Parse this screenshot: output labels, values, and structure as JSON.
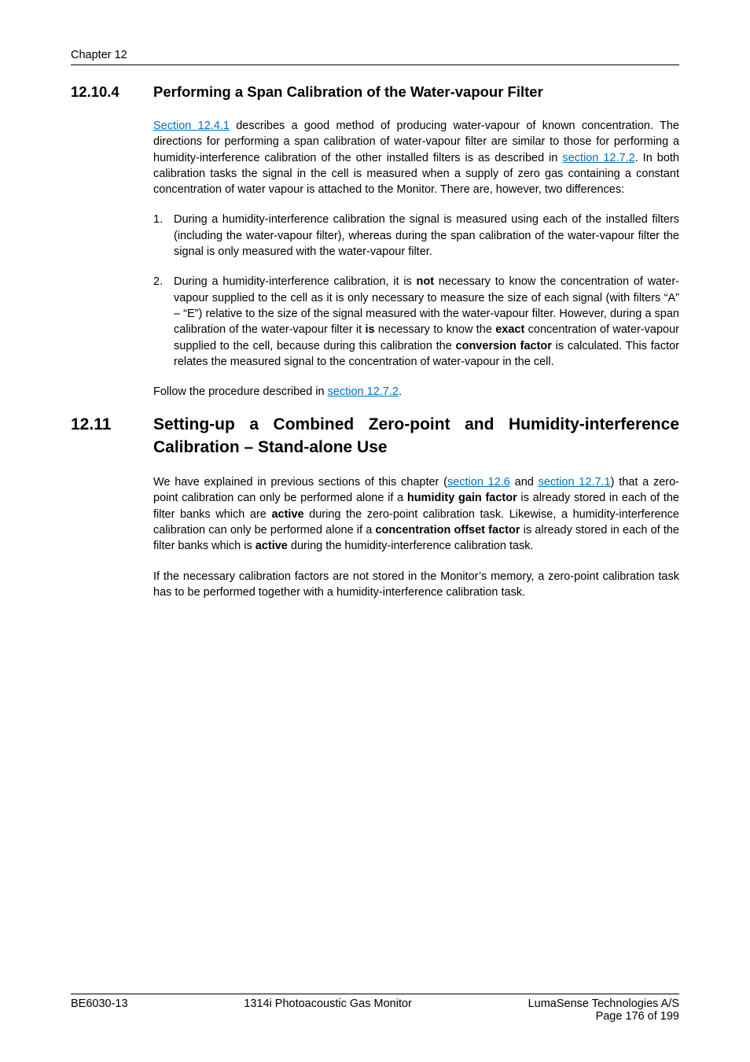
{
  "header": {
    "chapter": "Chapter 12"
  },
  "section_12_10_4": {
    "number": "12.10.4",
    "title": "Performing a Span Calibration of the Water-vapour Filter",
    "para1_a": "Section 12.4.1",
    "para1_b": " describes a good method of producing water-vapour of known concentration. The directions for performing a span calibration of water-vapour filter are similar to those for performing a humidity-interference calibration of the other installed filters is as described in ",
    "para1_c": "section 12.7.2",
    "para1_d": ". In both calibration tasks the signal in the cell is measured when a supply of zero gas containing a constant concentration of water vapour is attached to the Monitor. There are, however, two differences:",
    "li1_num": "1.",
    "li1_text": "During a humidity-interference calibration the signal is measured using each of the installed filters (including the water-vapour filter), whereas during the span calibration of the water-vapour filter the signal is only measured with the water-vapour filter.",
    "li2_num": "2.",
    "li2_a": "During a humidity-interference calibration, it is ",
    "li2_b": "not",
    "li2_c": " necessary to know the concentration of water-vapour supplied to the cell as it is only necessary to measure the size of each signal (with filters “A” – “E”) relative to the size of the signal measured with the water-vapour filter. However, during a span calibration of the water-vapour filter it ",
    "li2_d": "is",
    "li2_e": " necessary to know the ",
    "li2_f": "exact",
    "li2_g": " concentration of water-vapour supplied to the cell, because during this calibration the ",
    "li2_h": "conversion factor",
    "li2_i": " is calculated. This factor relates the measured signal to the concentration of water-vapour in the cell.",
    "para2_a": "Follow the procedure described in ",
    "para2_b": "section 12.7.2",
    "para2_c": "."
  },
  "section_12_11": {
    "number": "12.11",
    "title": "Setting-up a Combined Zero-point and Humidity-interference Calibration – Stand-alone Use",
    "para1_a": "We have explained in previous sections of this chapter (",
    "para1_b": "section 12.6",
    "para1_c": " and ",
    "para1_d": "section 12.7.1",
    "para1_e": ") that a zero-point calibration can only be performed alone if a ",
    "para1_f": "humidity gain factor",
    "para1_g": " is already stored in each of the filter banks which are ",
    "para1_h": "active",
    "para1_i": " during the zero-point calibration task. Likewise, a humidity-interference calibration can only be performed alone if a ",
    "para1_j": "concentration offset factor",
    "para1_k": " is already stored in each of the filter banks which is ",
    "para1_l": "active",
    "para1_m": " during the humidity-interference calibration task.",
    "para2": "If the necessary calibration factors are not stored in the Monitor’s memory, a zero-point calibration task has to be performed together with a humidity-interference calibration task."
  },
  "footer": {
    "left": "BE6030-13",
    "center": "1314i Photoacoustic Gas Monitor",
    "right": "LumaSense Technologies A/S",
    "page": "Page 176 of 199"
  }
}
